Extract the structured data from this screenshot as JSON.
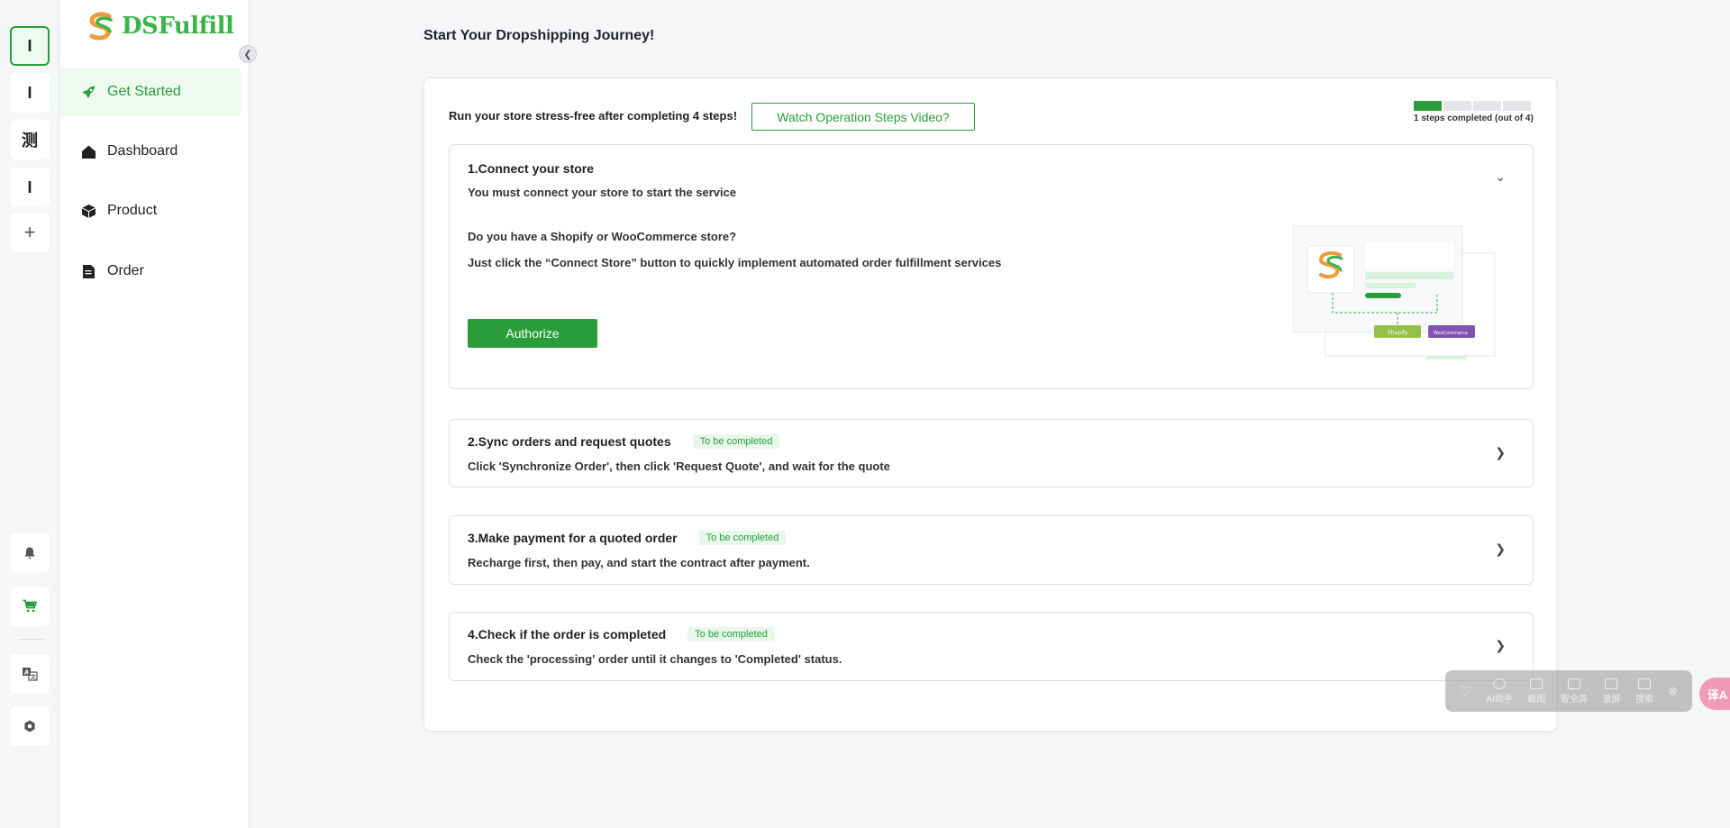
{
  "rail": {
    "items": [
      {
        "label": "I"
      },
      {
        "label": "I"
      },
      {
        "label": "测"
      },
      {
        "label": "I"
      },
      {
        "label": "+"
      }
    ]
  },
  "sidebar": {
    "logo_text": "DSFulfill",
    "items": [
      {
        "label": "Get Started",
        "icon": "rocket-icon"
      },
      {
        "label": "Dashboard",
        "icon": "home-icon"
      },
      {
        "label": "Product",
        "icon": "box-icon"
      },
      {
        "label": "Order",
        "icon": "document-icon"
      }
    ]
  },
  "main": {
    "title": "Start Your Dropshipping Journey!",
    "run_text": "Run your store stress-free after completing 4 steps!",
    "video_button": "Watch Operation Steps Video?",
    "progress": {
      "completed": 1,
      "total": 4,
      "text": "1 steps completed (out of 4)"
    },
    "steps": [
      {
        "title": "1.Connect your store",
        "desc": "You must connect your store to start the service",
        "question": "Do you have a Shopify or WooCommerce store?",
        "instruction": "Just click the “Connect Store” button to quickly implement automated order fulfillment services",
        "button": "Authorize"
      },
      {
        "title": "2.Sync orders and request quotes",
        "badge": "To be completed",
        "desc": "Click 'Synchronize Order', then click 'Request Quote', and wait for the quote"
      },
      {
        "title": "3.Make payment for a quoted order",
        "badge": "To be completed",
        "desc": "Recharge first, then pay, and start the contract after payment."
      },
      {
        "title": "4.Check if the order is completed",
        "badge": "To be completed",
        "desc": "Check the 'processing' order until it changes to 'Completed' status."
      }
    ],
    "illustration": {
      "shopify_label": "Shopify",
      "woo_label": "WooCommerce"
    }
  },
  "float_toolbar": {
    "items": [
      "AI助手",
      "截图",
      "智全屏",
      "录屏",
      "搜索"
    ],
    "translate": "译A"
  },
  "colors": {
    "accent": "#2a9d3a",
    "accent_light": "#eefaf0"
  }
}
